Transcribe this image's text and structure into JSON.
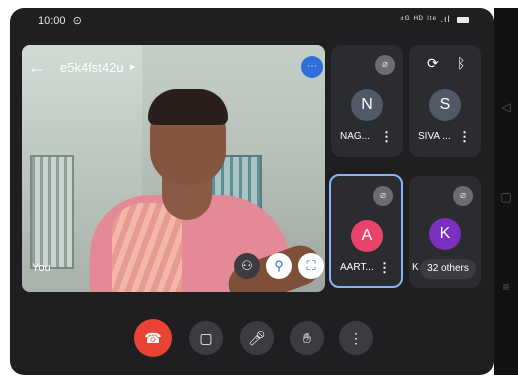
{
  "status_bar": {
    "time": "10:00",
    "time_icon": "notification-icon",
    "signal_text": "⁴ᴳ ᴴᴰ ˡᵗᵉ .ıl"
  },
  "meeting": {
    "code": "e5k4fst42u",
    "chevron": "▸",
    "self_label": "You"
  },
  "participants": [
    {
      "name": "NAG...",
      "initial": "N",
      "avatar_color": "#4f5a66"
    },
    {
      "name": "SIVA ...",
      "initial": "S",
      "avatar_color": "#4f5a66"
    },
    {
      "name": "AART...",
      "initial": "A",
      "avatar_color": "#e8446b"
    },
    {
      "name": "K",
      "initial": "K",
      "avatar_color": "#7b2fbf"
    }
  ],
  "others_label": "32 others",
  "colors": {
    "end_call": "#ea4335",
    "accent": "#2f6fdb",
    "selected_border": "#8ab4f8",
    "background": "#1f1f22"
  },
  "icons": {
    "back": "arrow-left-icon",
    "video_toggle": "camera-icon",
    "mic": "microphone-icon",
    "hand": "raise-hand-icon",
    "more": "more-vert-icon",
    "end": "call-end-icon",
    "pin": "pin-icon",
    "expand": "fullscreen-icon",
    "effects": "effects-icon"
  }
}
